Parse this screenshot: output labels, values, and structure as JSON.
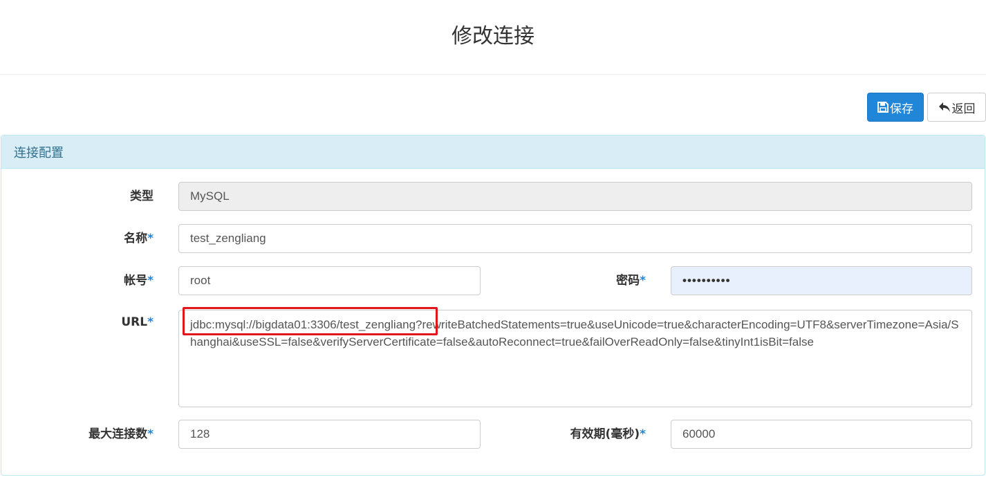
{
  "header": {
    "title": "修改连接"
  },
  "toolbar": {
    "save_label": "保存",
    "back_label": "返回"
  },
  "panel": {
    "title": "连接配置"
  },
  "form": {
    "type": {
      "label": "类型",
      "value": "MySQL"
    },
    "name": {
      "label": "名称",
      "required_mark": "*",
      "value": "test_zengliang"
    },
    "account": {
      "label": "帐号",
      "required_mark": "*",
      "value": "root"
    },
    "password": {
      "label": "密码",
      "required_mark": "*",
      "value": "••••••••••"
    },
    "url": {
      "label": "URL",
      "required_mark": "*",
      "value": "jdbc:mysql://bigdata01:3306/test_zengliang?rewriteBatchedStatements=true&useUnicode=true&characterEncoding=UTF8&serverTimezone=Asia/Shanghai&useSSL=false&verifyServerCertificate=false&autoReconnect=true&failOverReadOnly=false&tinyInt1isBit=false"
    },
    "max_connections": {
      "label": "最大连接数",
      "required_mark": "*",
      "value": "128"
    },
    "validity": {
      "label": "有效期(毫秒)",
      "required_mark": "*",
      "value": "60000"
    }
  },
  "colors": {
    "primary": "#2185d8",
    "panel_heading_bg": "#d9edf7",
    "panel_heading_text": "#31708f",
    "highlight": "#e0161b"
  },
  "icons": {
    "save": "floppy-disk-icon",
    "back": "reply-arrow-icon"
  }
}
